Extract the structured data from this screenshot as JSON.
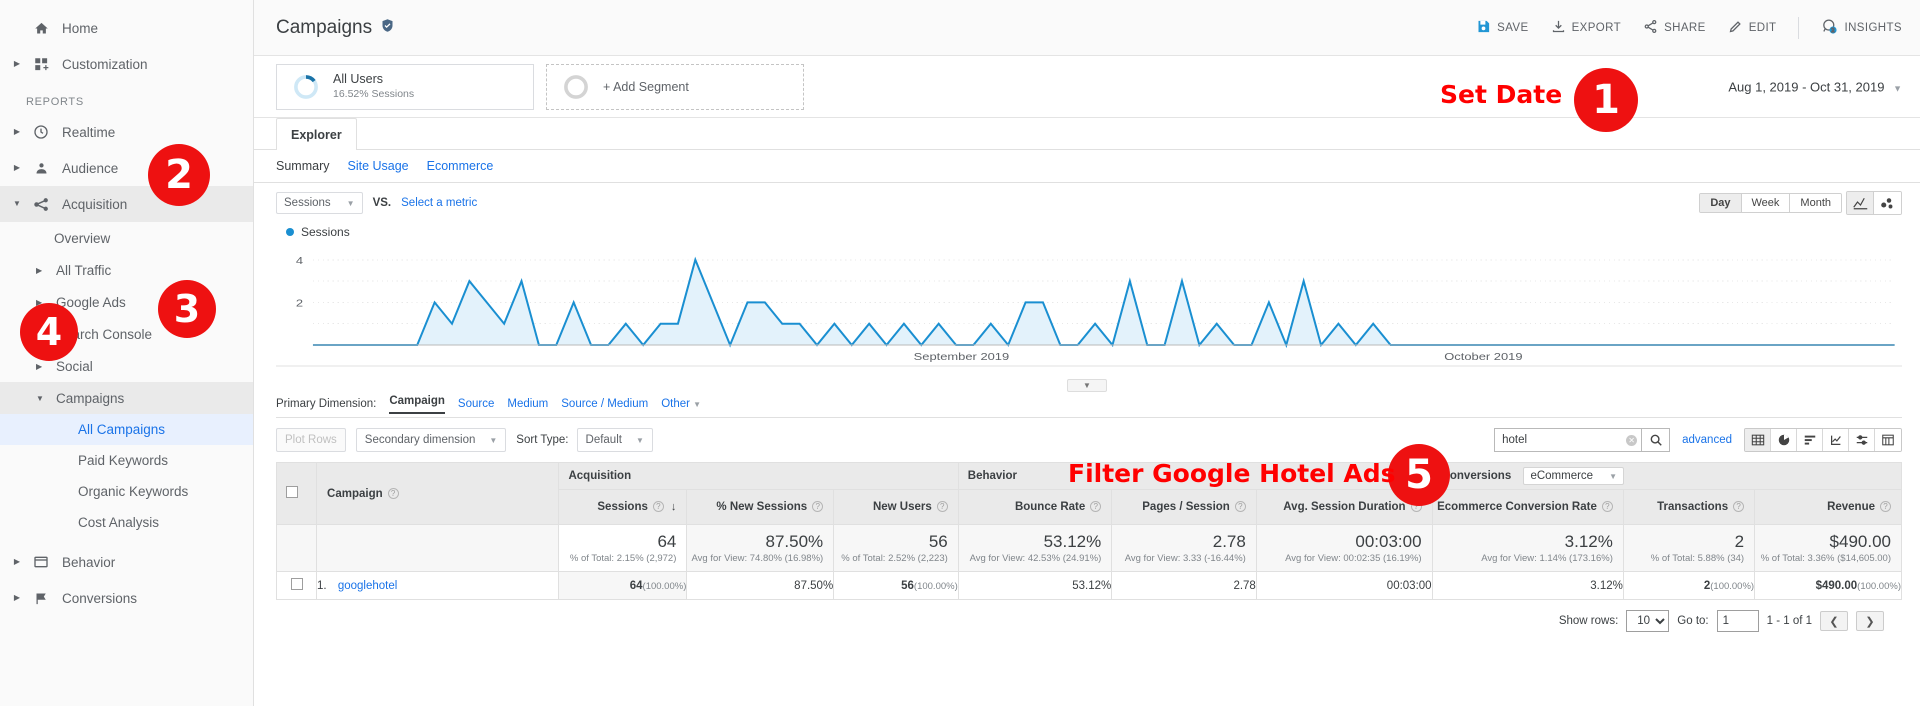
{
  "sidebar": {
    "top_items": [
      {
        "label": "Home",
        "icon": "home-icon",
        "expandable": false
      },
      {
        "label": "Customization",
        "icon": "customization-icon",
        "expandable": true
      }
    ],
    "section_title": "REPORTS",
    "report_items": [
      {
        "label": "Realtime",
        "icon": "clock-icon",
        "expandable": true,
        "expanded": false
      },
      {
        "label": "Audience",
        "icon": "person-icon",
        "expandable": true,
        "expanded": false
      },
      {
        "label": "Acquisition",
        "icon": "acquisition-icon",
        "expandable": true,
        "expanded": true
      }
    ],
    "acquisition_children": [
      {
        "label": "Overview",
        "arrow": false
      },
      {
        "label": "All Traffic",
        "arrow": true
      },
      {
        "label": "Google Ads",
        "arrow": true
      },
      {
        "label": "Search Console",
        "arrow": true
      },
      {
        "label": "Social",
        "arrow": true
      },
      {
        "label": "Campaigns",
        "arrow": true,
        "expanded": true
      }
    ],
    "campaign_children": [
      {
        "label": "All Campaigns",
        "selected": true
      },
      {
        "label": "Paid Keywords",
        "selected": false
      },
      {
        "label": "Organic Keywords",
        "selected": false
      },
      {
        "label": "Cost Analysis",
        "selected": false
      }
    ],
    "bottom_items": [
      {
        "label": "Behavior",
        "icon": "behavior-icon",
        "expandable": true
      },
      {
        "label": "Conversions",
        "icon": "flag-icon",
        "expandable": true
      }
    ]
  },
  "header": {
    "title": "Campaigns",
    "shield_icon": "verified-shield-icon",
    "actions": [
      {
        "label": "SAVE",
        "icon": "save-icon"
      },
      {
        "label": "EXPORT",
        "icon": "export-icon"
      },
      {
        "label": "SHARE",
        "icon": "share-icon"
      },
      {
        "label": "EDIT",
        "icon": "edit-pencil-icon"
      },
      {
        "label": "INSIGHTS",
        "icon": "insights-icon"
      }
    ]
  },
  "segments": {
    "all_users": {
      "name": "All Users",
      "sub": "16.52% Sessions"
    },
    "add_segment": "+ Add Segment"
  },
  "date_range": "Aug 1, 2019 - Oct 31, 2019",
  "explorer": {
    "tab_label": "Explorer",
    "metric_tabs": [
      {
        "label": "Summary",
        "selected": true
      },
      {
        "label": "Site Usage",
        "selected": false
      },
      {
        "label": "Ecommerce",
        "selected": false
      }
    ]
  },
  "chart_controls": {
    "metric_selector": "Sessions",
    "vs_label": "VS.",
    "select_metric": "Select a metric",
    "granularity": [
      {
        "label": "Day",
        "selected": true
      },
      {
        "label": "Week",
        "selected": false
      },
      {
        "label": "Month",
        "selected": false
      }
    ],
    "chart_types": [
      {
        "icon": "line-chart-icon",
        "selected": true
      },
      {
        "icon": "motion-chart-icon",
        "selected": false
      }
    ]
  },
  "chart_data": {
    "type": "area",
    "title": "",
    "series": [
      {
        "name": "Sessions",
        "color": "#1a8fd1",
        "values": [
          0,
          0,
          0,
          0,
          0,
          0,
          0,
          2,
          1,
          3,
          2,
          1,
          3,
          0,
          0,
          2,
          0,
          0,
          1,
          0,
          1,
          1,
          4,
          2,
          0,
          2,
          2,
          1,
          1,
          0,
          1,
          0,
          1,
          0,
          1,
          0,
          1,
          0,
          0,
          1,
          0,
          2,
          2,
          0,
          0,
          1,
          0,
          3,
          0,
          0,
          3,
          0,
          1,
          0,
          0,
          2,
          0,
          3,
          0,
          1,
          0,
          1,
          0,
          0,
          0,
          0,
          0,
          0,
          0,
          0,
          0,
          0,
          0,
          0,
          0,
          0,
          0,
          0,
          0,
          0,
          0,
          0,
          0,
          0,
          0,
          0,
          0,
          0,
          0,
          0,
          0,
          0
        ]
      }
    ],
    "ylabel": "",
    "xlabel": "",
    "ylim": [
      0,
      4.6
    ],
    "yticks": [
      2,
      4
    ],
    "grid": true,
    "legend": "Sessions",
    "legend_position": "top-left",
    "x_month_labels": [
      {
        "label": "September 2019",
        "pos": 0.41
      },
      {
        "label": "October 2019",
        "pos": 0.74
      }
    ]
  },
  "primary_dimension": {
    "label": "Primary Dimension:",
    "options": [
      {
        "label": "Campaign",
        "selected": true
      },
      {
        "label": "Source",
        "selected": false
      },
      {
        "label": "Medium",
        "selected": false
      },
      {
        "label": "Source / Medium",
        "selected": false
      },
      {
        "label": "Other",
        "selected": false,
        "caret": true
      }
    ]
  },
  "table_tools": {
    "plot_rows": "Plot Rows",
    "secondary_dimension": "Secondary dimension",
    "sort_type_label": "Sort Type:",
    "sort_type_value": "Default",
    "search_value": "hotel",
    "search_placeholder": "",
    "advanced": "advanced",
    "view_types": [
      {
        "icon": "table-view-icon",
        "selected": true
      },
      {
        "icon": "pie-view-icon",
        "selected": false
      },
      {
        "icon": "bar-view-icon",
        "selected": false
      },
      {
        "icon": "performance-view-icon",
        "selected": false
      },
      {
        "icon": "comparison-view-icon",
        "selected": false
      },
      {
        "icon": "pivot-view-icon",
        "selected": false
      }
    ]
  },
  "table": {
    "groups": [
      {
        "label": "Acquisition",
        "span": 3
      },
      {
        "label": "Behavior",
        "span": 3
      },
      {
        "label": "Conversions",
        "span": 3,
        "dropdown": "eCommerce"
      }
    ],
    "dimension_header": "Campaign",
    "columns": [
      {
        "label": "Sessions",
        "sorted": true
      },
      {
        "label": "% New Sessions",
        "sorted": false
      },
      {
        "label": "New Users",
        "sorted": false
      },
      {
        "label": "Bounce Rate",
        "sorted": false
      },
      {
        "label": "Pages / Session",
        "sorted": false
      },
      {
        "label": "Avg. Session Duration",
        "sorted": false
      },
      {
        "label": "Ecommerce Conversion Rate",
        "sorted": false
      },
      {
        "label": "Transactions",
        "sorted": false
      },
      {
        "label": "Revenue",
        "sorted": false
      }
    ],
    "summary": [
      {
        "value": "64",
        "sub": "% of Total: 2.15% (2,972)"
      },
      {
        "value": "87.50%",
        "sub": "Avg for View: 74.80% (16.98%)"
      },
      {
        "value": "56",
        "sub": "% of Total: 2.52% (2,223)"
      },
      {
        "value": "53.12%",
        "sub": "Avg for View: 42.53% (24.91%)"
      },
      {
        "value": "2.78",
        "sub": "Avg for View: 3.33 (-16.44%)"
      },
      {
        "value": "00:03:00",
        "sub": "Avg for View: 00:02:35 (16.19%)"
      },
      {
        "value": "3.12%",
        "sub": "Avg for View: 1.14% (173.16%)"
      },
      {
        "value": "2",
        "sub": "% of Total: 5.88% (34)"
      },
      {
        "value": "$490.00",
        "sub": "% of Total: 3.36% ($14,605.00)"
      }
    ],
    "rows": [
      {
        "index": "1.",
        "name": "googlehotel",
        "cells": [
          {
            "main": "64",
            "pct": "(100.00%)",
            "bold": true
          },
          {
            "main": "87.50%",
            "pct": "",
            "bold": false
          },
          {
            "main": "56",
            "pct": "(100.00%)",
            "bold": true
          },
          {
            "main": "53.12%",
            "pct": "",
            "bold": false
          },
          {
            "main": "2.78",
            "pct": "",
            "bold": false
          },
          {
            "main": "00:03:00",
            "pct": "",
            "bold": false
          },
          {
            "main": "3.12%",
            "pct": "",
            "bold": false
          },
          {
            "main": "2",
            "pct": "(100.00%)",
            "bold": true
          },
          {
            "main": "$490.00",
            "pct": "(100.00%)",
            "bold": true
          }
        ]
      }
    ]
  },
  "pagination": {
    "show_rows_label": "Show rows:",
    "rows_value": "10",
    "goto_label": "Go to:",
    "goto_value": "1",
    "range_text": "1 - 1 of 1",
    "prev_icon": "chevron-left-icon",
    "next_icon": "chevron-right-icon"
  },
  "annotations": [
    {
      "id": "1",
      "number": "1",
      "text": "Set Date"
    },
    {
      "id": "2",
      "number": "2",
      "text": ""
    },
    {
      "id": "3",
      "number": "3",
      "text": ""
    },
    {
      "id": "4",
      "number": "4",
      "text": ""
    },
    {
      "id": "5",
      "number": "5",
      "text": "Filter Google Hotel Ads"
    }
  ],
  "colors": {
    "accent": "#1a73e8",
    "chart_line": "#1a8fd1",
    "annotation": "#ee1111"
  }
}
